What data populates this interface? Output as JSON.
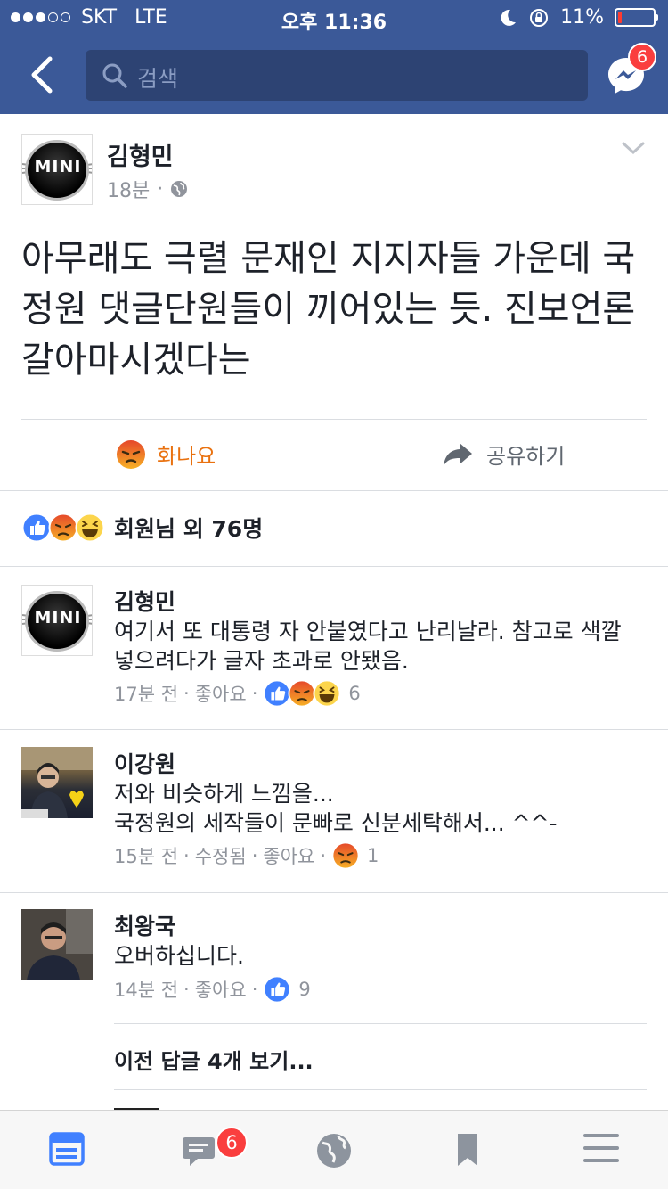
{
  "status_bar": {
    "carrier": "SKT",
    "network": "LTE",
    "time": "오후 11:36",
    "battery_percent": "11%",
    "battery_level": 0.11
  },
  "nav": {
    "search_placeholder": "검색",
    "messenger_badge": "6"
  },
  "post": {
    "author": "김형민",
    "time": "18분",
    "privacy_icon": "globe-icon",
    "text": "아무래도 극렬 문재인 지지자들 가운데 국정원 댓글단원들이 끼어있는 듯. 진보언론 갈아마시겠다는",
    "actions": {
      "reaction_label": "화나요",
      "share_label": "공유하기"
    },
    "reaction_summary": "회원님 외 76명"
  },
  "comments": [
    {
      "author": "김형민",
      "text": "여기서 또 대통령 자 안붙였다고 난리날라.   참고로 색깔 넣으려다가 글자 초과로 안됐음.",
      "time": "17분 전",
      "edited": "",
      "like_label": "좋아요",
      "reactions": [
        "like",
        "angry",
        "haha"
      ],
      "count": "6"
    },
    {
      "author": "이강원",
      "text": "저와 비슷하게 느낌을...\n국정원의 세작들이 문빠로 신분세탁해서... ^^-",
      "time": "15분 전",
      "edited": "수정됨",
      "like_label": "좋아요",
      "reactions": [
        "angry"
      ],
      "count": "1"
    },
    {
      "author": "최왕국",
      "text": "오버하십니다.",
      "time": "14분 전",
      "edited": "",
      "like_label": "좋아요",
      "reactions": [
        "like"
      ],
      "count": "9"
    }
  ],
  "view_previous_replies": "이전 답글 4개 보기...",
  "tab_bar": {
    "tabs": [
      "news-feed-icon",
      "requests-icon",
      "globe-icon",
      "bookmark-icon",
      "menu-icon"
    ],
    "requests_badge": "6"
  },
  "colors": {
    "brand": "#3b5998",
    "angry": "#e9710f",
    "badge": "#fa3e3e",
    "meta": "#90949c"
  }
}
